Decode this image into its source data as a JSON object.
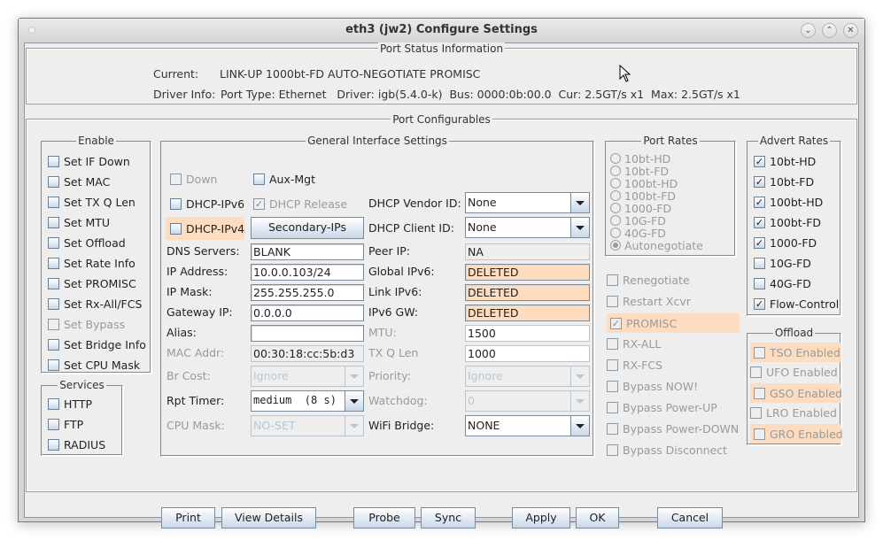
{
  "window": {
    "title": "eth3  (jw2) Configure Settings",
    "controls": [
      "minimize",
      "maximize",
      "close"
    ]
  },
  "status": {
    "legend": "Port Status Information",
    "current_label": "Current:",
    "current_value": "LINK-UP 1000bt-FD AUTO-NEGOTIATE PROMISC",
    "driver_label": "Driver Info:",
    "driver_value": "Port Type: Ethernet   Driver: igb(5.4.0-k)  Bus: 0000:0b:00.0  Cur: 2.5GT/s x1  Max: 2.5GT/s x1"
  },
  "configurables": {
    "legend": "Port Configurables"
  },
  "enable": {
    "legend": "Enable",
    "items": [
      {
        "label": "Set IF Down",
        "checked": false,
        "disabled": false
      },
      {
        "label": "Set MAC",
        "checked": false,
        "disabled": false
      },
      {
        "label": "Set TX Q Len",
        "checked": false,
        "disabled": false
      },
      {
        "label": "Set MTU",
        "checked": false,
        "disabled": false
      },
      {
        "label": "Set Offload",
        "checked": false,
        "disabled": false
      },
      {
        "label": "Set Rate Info",
        "checked": false,
        "disabled": false
      },
      {
        "label": "Set PROMISC",
        "checked": false,
        "disabled": false
      },
      {
        "label": "Set Rx-All/FCS",
        "checked": false,
        "disabled": false
      },
      {
        "label": "Set Bypass",
        "checked": false,
        "disabled": true
      },
      {
        "label": "Set Bridge Info",
        "checked": false,
        "disabled": false
      },
      {
        "label": "Set CPU Mask",
        "checked": false,
        "disabled": false
      }
    ]
  },
  "services": {
    "legend": "Services",
    "items": [
      {
        "label": "HTTP",
        "checked": false
      },
      {
        "label": "FTP",
        "checked": false
      },
      {
        "label": "RADIUS",
        "checked": false
      }
    ]
  },
  "general": {
    "legend": "General Interface Settings",
    "down": {
      "label": "Down",
      "checked": false,
      "disabled": true
    },
    "aux_mgt": {
      "label": "Aux-Mgt",
      "checked": false
    },
    "dhcp_ipv6": {
      "label": "DHCP-IPv6",
      "checked": false
    },
    "dhcp_release": {
      "label": "DHCP Release",
      "checked": true,
      "disabled": true
    },
    "dhcp_ipv4": {
      "label": "DHCP-IPv4",
      "checked": false
    },
    "secondary_ips": "Secondary-IPs",
    "dhcp_vendor_id": {
      "label": "DHCP Vendor ID:",
      "value": "None"
    },
    "dhcp_client_id": {
      "label": "DHCP Client ID:",
      "value": "None"
    },
    "dns_servers": {
      "label": "DNS Servers:",
      "value": "BLANK"
    },
    "peer_ip": {
      "label": "Peer IP:",
      "value": "NA"
    },
    "ip_address": {
      "label": "IP Address:",
      "value": "10.0.0.103/24"
    },
    "global_ipv6": {
      "label": "Global IPv6:",
      "value": "DELETED"
    },
    "ip_mask": {
      "label": "IP Mask:",
      "value": "255.255.255.0"
    },
    "link_ipv6": {
      "label": "Link IPv6:",
      "value": "DELETED"
    },
    "gateway_ip": {
      "label": "Gateway IP:",
      "value": "0.0.0.0"
    },
    "ipv6_gw": {
      "label": "IPv6 GW:",
      "value": "DELETED"
    },
    "alias": {
      "label": "Alias:",
      "value": ""
    },
    "mtu": {
      "label": "MTU:",
      "value": "1500"
    },
    "mac_addr": {
      "label": "MAC Addr:",
      "value": "00:30:18:cc:5b:d3"
    },
    "tx_q_len": {
      "label": "TX Q Len",
      "value": "1000"
    },
    "br_cost": {
      "label": "Br Cost:",
      "value": "Ignore"
    },
    "priority": {
      "label": "Priority:",
      "value": "Ignore"
    },
    "rpt_timer": {
      "label": "Rpt Timer:",
      "value": "medium  (8 s)"
    },
    "watchdog": {
      "label": "Watchdog:",
      "value": "0"
    },
    "cpu_mask": {
      "label": "CPU Mask:",
      "value": "NO-SET"
    },
    "wifi_bridge": {
      "label": "WiFi Bridge:",
      "value": "NONE"
    }
  },
  "port_rates": {
    "legend": "Port Rates",
    "options": [
      "10bt-HD",
      "10bt-FD",
      "100bt-HD",
      "100bt-FD",
      "1000-FD",
      "10G-FD",
      "40G-FD",
      "Autonegotiate"
    ],
    "selected": "Autonegotiate"
  },
  "port_flags": [
    {
      "label": "Renegotiate",
      "checked": false,
      "highlight": false
    },
    {
      "label": "Restart Xcvr",
      "checked": false,
      "highlight": false
    },
    {
      "label": "PROMISC",
      "checked": true,
      "highlight": true
    },
    {
      "label": "RX-ALL",
      "checked": false,
      "highlight": false
    },
    {
      "label": "RX-FCS",
      "checked": false,
      "highlight": false
    },
    {
      "label": "Bypass NOW!",
      "checked": false,
      "highlight": false
    },
    {
      "label": "Bypass Power-UP",
      "checked": false,
      "highlight": false
    },
    {
      "label": "Bypass Power-DOWN",
      "checked": false,
      "highlight": false
    },
    {
      "label": "Bypass Disconnect",
      "checked": false,
      "highlight": false
    }
  ],
  "advert_rates": {
    "legend": "Advert Rates",
    "items": [
      {
        "label": "10bt-HD",
        "checked": true
      },
      {
        "label": "10bt-FD",
        "checked": true
      },
      {
        "label": "100bt-HD",
        "checked": true
      },
      {
        "label": "100bt-FD",
        "checked": true
      },
      {
        "label": "1000-FD",
        "checked": true
      },
      {
        "label": "10G-FD",
        "checked": false
      },
      {
        "label": "40G-FD",
        "checked": false
      },
      {
        "label": "Flow-Control",
        "checked": true
      }
    ]
  },
  "offload": {
    "legend": "Offload",
    "items": [
      {
        "label": "TSO Enabled",
        "checked": false,
        "highlight": true
      },
      {
        "label": "UFO Enabled",
        "checked": false,
        "highlight": false
      },
      {
        "label": "GSO Enabled",
        "checked": false,
        "highlight": true
      },
      {
        "label": "LRO Enabled",
        "checked": false,
        "highlight": false
      },
      {
        "label": "GRO Enabled",
        "checked": false,
        "highlight": true
      }
    ]
  },
  "buttons": {
    "print": "Print",
    "view_details": "View Details",
    "probe": "Probe",
    "sync": "Sync",
    "apply": "Apply",
    "ok": "OK",
    "cancel": "Cancel"
  },
  "colors": {
    "highlight": "#fedcbf",
    "panel_bg": "#eeeeee",
    "border": "#7a8a99"
  }
}
